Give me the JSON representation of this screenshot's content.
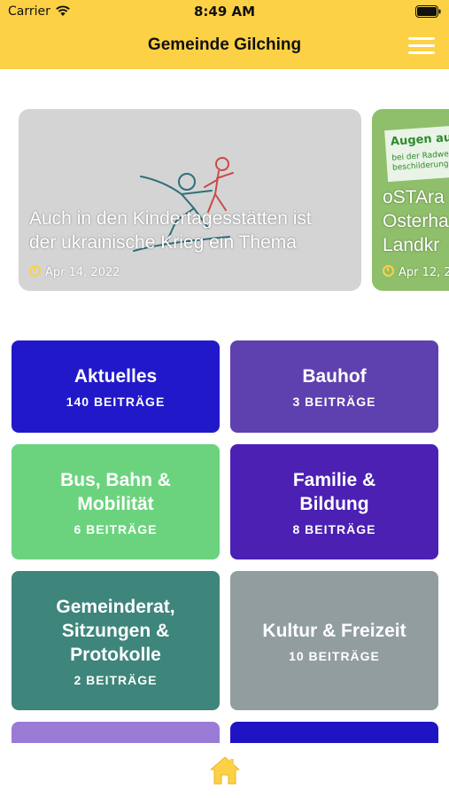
{
  "status_bar": {
    "carrier": "Carrier",
    "time": "8:49 AM"
  },
  "header": {
    "title": "Gemeinde Gilching"
  },
  "colors": {
    "accent": "#fdd146"
  },
  "carousel": [
    {
      "title_line1": "Auch in den Kindertagesstätten ist",
      "title_line2": "der ukrainische Krieg ein Thema",
      "date": "Apr 14, 2022"
    },
    {
      "title_line1": "oSTAra",
      "title_line2": "Osterha",
      "title_line3": "Landkr",
      "date": "Apr 12, 2",
      "poster_line1": "Augen auf",
      "poster_line2": "bei der Radweg",
      "poster_line3": "beschilderung!"
    }
  ],
  "categories": [
    {
      "name_lines": [
        "Aktuelles"
      ],
      "count": "140 BEITRÄGE",
      "color": "#2119c9"
    },
    {
      "name_lines": [
        "Bauhof"
      ],
      "count": "3 BEITRÄGE",
      "color": "#5e40ae"
    },
    {
      "name_lines": [
        "Bus, Bahn &",
        "Mobilität"
      ],
      "count": "6 BEITRÄGE",
      "color": "#6bd37e"
    },
    {
      "name_lines": [
        "Familie &",
        "Bildung"
      ],
      "count": "8 BEITRÄGE",
      "color": "#4b20b2"
    },
    {
      "name_lines": [
        "Gemeinderat,",
        "Sitzungen &",
        "Protokolle"
      ],
      "count": "2 BEITRÄGE",
      "color": "#3e857b"
    },
    {
      "name_lines": [
        "Kultur & Freizeit"
      ],
      "count": "10 BEITRÄGE",
      "color": "#929da0"
    },
    {
      "color": "#9a7bd6"
    },
    {
      "color": "#1f14c4"
    }
  ],
  "nav": {
    "home_icon": "home-icon"
  }
}
